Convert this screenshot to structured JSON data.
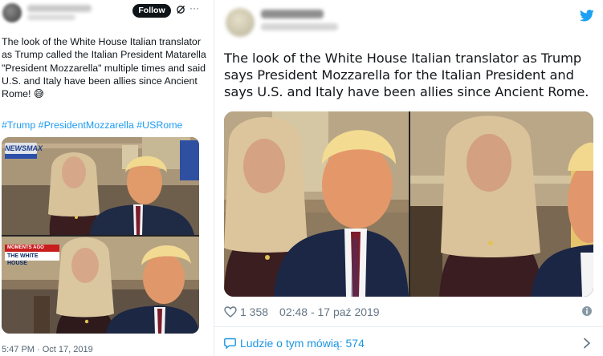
{
  "left_tweet": {
    "follow_label": "Follow",
    "more_label": "···",
    "text": "The look of the White House Italian translator as Trump called the Italian President Matarella \"President Mozzarella\" multiple times and said U.S. and Italy have been allies since Ancient Rome! 😅",
    "hashtags": "#Trump #PresidentMozzarella #USRome",
    "timestamp": "5:47 PM · Oct 17, 2019",
    "media": {
      "top_logo": "NEWSMAX",
      "ticker_top": "MOMENTS AGO",
      "ticker_bottom": "THE WHITE HOUSE"
    }
  },
  "right_tweet": {
    "text": "The look of the White House Italian translator as Trump says President Mozzarella for the Italian President and says U.S. and Italy have been allies since Ancient Rome.",
    "likes": "1 358",
    "timestamp": "02:48 - 17 paź 2019",
    "conversation_label": "Ludzie o tym mówią: 574"
  },
  "colors": {
    "accent": "#1d9bf0",
    "twitter_blue": "#1da1f2",
    "text": "#0f1419",
    "muted": "#536471"
  },
  "icons": [
    "grok-icon",
    "more-icon",
    "twitter-bird-icon",
    "heart-icon",
    "info-icon",
    "speech-bubble-icon",
    "chevron-right-icon"
  ]
}
